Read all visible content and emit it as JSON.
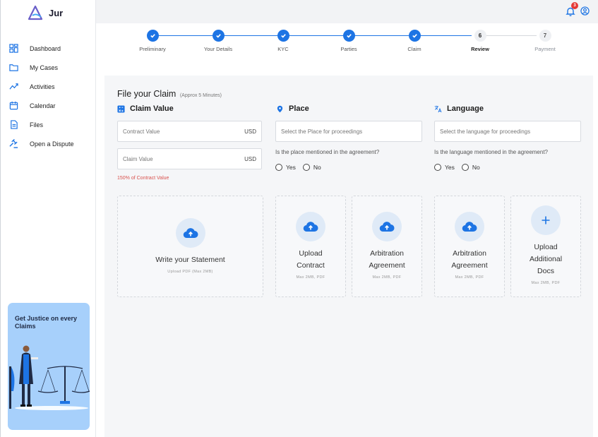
{
  "app": {
    "name": "Jur"
  },
  "sidebar": {
    "items": [
      {
        "label": "Dashboard",
        "icon": "dashboard-icon"
      },
      {
        "label": "My Cases",
        "icon": "folder-icon"
      },
      {
        "label": "Activities",
        "icon": "activity-icon"
      },
      {
        "label": "Calendar",
        "icon": "calendar-icon"
      },
      {
        "label": "Files",
        "icon": "file-icon"
      },
      {
        "label": "Open a Dispute",
        "icon": "gavel-icon"
      }
    ],
    "promo": {
      "title": "Get Justice on every Claims"
    }
  },
  "topbar": {
    "notification_count": "3"
  },
  "stepper": {
    "steps": [
      {
        "label": "Preliminary",
        "status": "done"
      },
      {
        "label": "Your Details",
        "status": "done"
      },
      {
        "label": "KYC",
        "status": "done"
      },
      {
        "label": "Parties",
        "status": "done"
      },
      {
        "label": "Claim",
        "status": "done"
      },
      {
        "label": "Review",
        "status": "current",
        "number": "6"
      },
      {
        "label": "Payment",
        "status": "pending",
        "number": "7"
      }
    ]
  },
  "form": {
    "title": "File your Claim",
    "subtitle": "(Approx 5 Minutes)",
    "claim_value": {
      "heading": "Claim Value",
      "contract_placeholder": "Contract Value",
      "contract_unit": "USD",
      "claim_placeholder": "Claim Value",
      "claim_unit": "USD",
      "hint": "150% of Contract Value"
    },
    "place": {
      "heading": "Place",
      "placeholder": "Select the Place for proceedings",
      "question": "Is the place mentioned in the agreement?",
      "yes": "Yes",
      "no": "No"
    },
    "language": {
      "heading": "Language",
      "placeholder": "Select the language for proceedings",
      "question": "Is the language mentioned in the agreement?",
      "yes": "Yes",
      "no": "No"
    },
    "uploads": {
      "statement": {
        "line1": "Write your Statement",
        "note": "Upload PDF (Max 2MB)"
      },
      "contract": {
        "line1": "Upload",
        "line2": "Contract",
        "note": "Max 2MB, PDF"
      },
      "arbitration1": {
        "line1": "Arbitration",
        "line2": "Agreement",
        "note": "Max 2MB, PDF"
      },
      "arbitration2": {
        "line1": "Arbitration",
        "line2": "Agreement",
        "note": "Max 2MB, PDF"
      },
      "additional": {
        "line1": "Upload",
        "line2": "Additional",
        "line3": "Docs",
        "note": "Max 2MB, PDF"
      }
    }
  },
  "colors": {
    "accent": "#1d74e4",
    "error": "#d9534f",
    "promo_bg": "#a7d0fb"
  }
}
